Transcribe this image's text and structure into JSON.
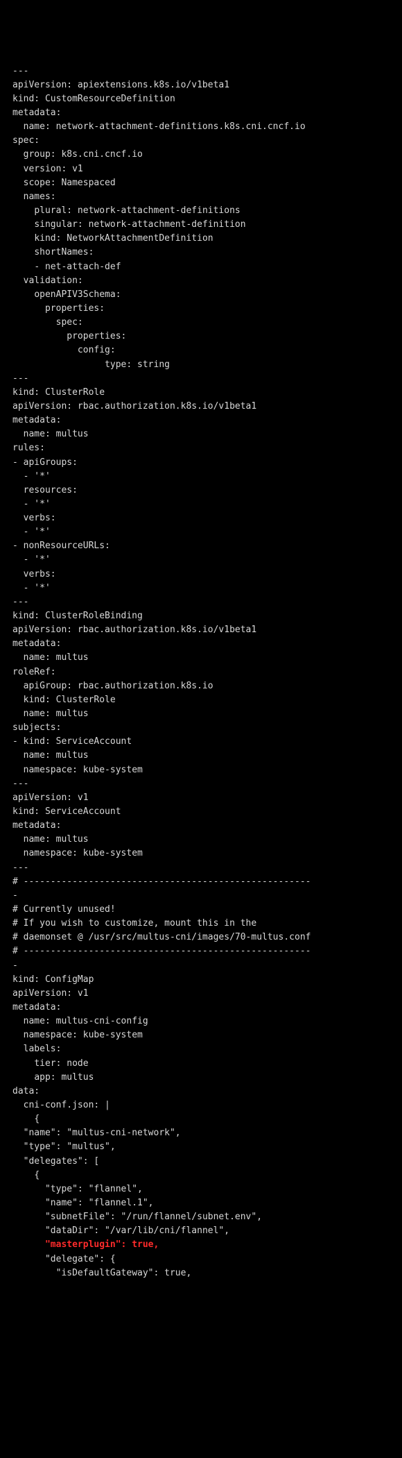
{
  "code": {
    "lines": [
      "---",
      "apiVersion: apiextensions.k8s.io/v1beta1",
      "kind: CustomResourceDefinition",
      "metadata:",
      "  name: network-attachment-definitions.k8s.cni.cncf.io",
      "spec:",
      "  group: k8s.cni.cncf.io",
      "  version: v1",
      "  scope: Namespaced",
      "  names:",
      "    plural: network-attachment-definitions",
      "    singular: network-attachment-definition",
      "    kind: NetworkAttachmentDefinition",
      "    shortNames:",
      "    - net-attach-def",
      "  validation:",
      "    openAPIV3Schema:",
      "      properties:",
      "        spec:",
      "          properties:",
      "            config:",
      "                 type: string",
      "---",
      "kind: ClusterRole",
      "apiVersion: rbac.authorization.k8s.io/v1beta1",
      "metadata:",
      "  name: multus",
      "rules:",
      "- apiGroups:",
      "  - '*'",
      "  resources:",
      "  - '*'",
      "  verbs:",
      "  - '*'",
      "- nonResourceURLs:",
      "  - '*'",
      "  verbs:",
      "  - '*'",
      "---",
      "kind: ClusterRoleBinding",
      "apiVersion: rbac.authorization.k8s.io/v1beta1",
      "metadata:",
      "  name: multus",
      "roleRef:",
      "  apiGroup: rbac.authorization.k8s.io",
      "  kind: ClusterRole",
      "  name: multus",
      "subjects:",
      "- kind: ServiceAccount",
      "  name: multus",
      "  namespace: kube-system",
      "---",
      "apiVersion: v1",
      "kind: ServiceAccount",
      "metadata:",
      "  name: multus",
      "  namespace: kube-system",
      "---",
      "# -----------------------------------------------------",
      "-",
      "# Currently unused!",
      "# If you wish to customize, mount this in the",
      "# daemonset @ /usr/src/multus-cni/images/70-multus.conf",
      "# -----------------------------------------------------",
      "-",
      "kind: ConfigMap",
      "apiVersion: v1",
      "metadata:",
      "  name: multus-cni-config",
      "  namespace: kube-system",
      "  labels:",
      "    tier: node",
      "    app: multus",
      "data:",
      "  cni-conf.json: |",
      "    {",
      "  \"name\": \"multus-cni-network\",",
      "  \"type\": \"multus\",",
      "  \"delegates\": [",
      "    {",
      "      \"type\": \"flannel\",",
      "      \"name\": \"flannel.1\",",
      "      \"subnetFile\": \"/run/flannel/subnet.env\",",
      "      \"dataDir\": \"/var/lib/cni/flannel\",",
      "      \"masterplugin\": true,",
      "      \"delegate\": {",
      "        \"isDefaultGateway\": true,"
    ],
    "highlightIndex": 84,
    "highlightPrefix": "      ",
    "highlightText": "\"masterplugin\": true,"
  }
}
